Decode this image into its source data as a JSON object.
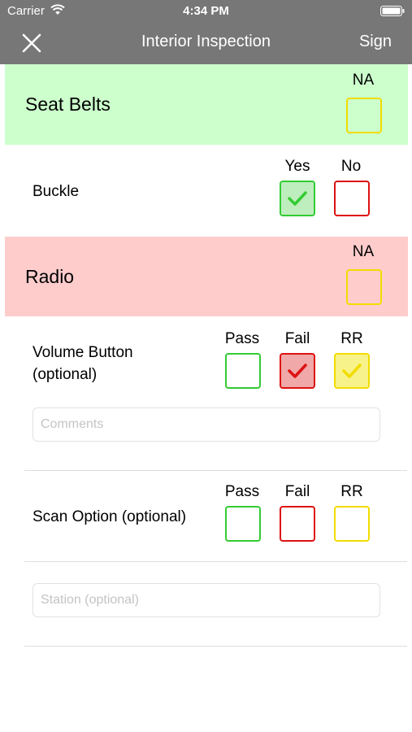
{
  "status_bar": {
    "carrier": "Carrier",
    "time": "4:34 PM"
  },
  "nav": {
    "title": "Interior Inspection",
    "sign_label": "Sign",
    "close_icon": "close-icon"
  },
  "colors": {
    "nav_bg": "#777777",
    "green_section": "#ccffcc",
    "red_section": "#ffcccc",
    "green": "#33cc33",
    "red": "#dd1111",
    "yellow": "#f2dc00"
  },
  "sections": [
    {
      "title": "Seat Belts",
      "na_label": "NA",
      "na_checked": false,
      "items": [
        {
          "label": "Buckle",
          "columns": [
            "Yes",
            "No"
          ],
          "checked": [
            "Yes"
          ]
        }
      ]
    },
    {
      "title": "Radio",
      "na_label": "NA",
      "na_checked": false,
      "items": [
        {
          "label_line1": "Volume Button",
          "label_line2": "(optional)",
          "columns": [
            "Pass",
            "Fail",
            "RR"
          ],
          "checked": [
            "Fail",
            "RR"
          ],
          "comments_placeholder": "Comments",
          "comments_value": ""
        },
        {
          "label": "Scan Option (optional)",
          "columns": [
            "Pass",
            "Fail",
            "RR"
          ],
          "checked": [],
          "station_placeholder": "Station (optional)",
          "station_value": ""
        }
      ]
    }
  ]
}
